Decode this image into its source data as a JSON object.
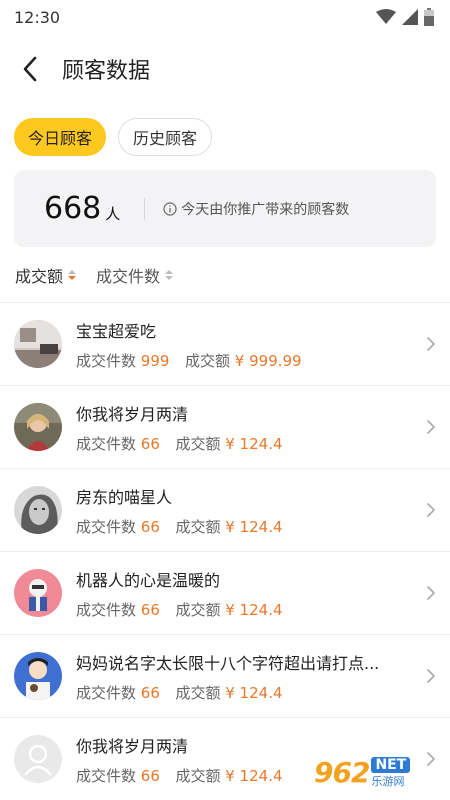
{
  "status_bar": {
    "time": "12:30"
  },
  "header": {
    "title": "顾客数据"
  },
  "tabs": [
    {
      "label": "今日顾客",
      "active": true
    },
    {
      "label": "历史顾客",
      "active": false
    }
  ],
  "summary": {
    "count": "668",
    "unit": "人",
    "note": "今天由你推广带来的顾客数"
  },
  "sort": [
    {
      "label": "成交额",
      "active": true
    },
    {
      "label": "成交件数",
      "active": false
    }
  ],
  "customers": [
    {
      "name": "宝宝超爱吃",
      "qty_label": "成交件数",
      "qty": "999",
      "amount_label": "成交额",
      "amount": "¥ 999.99",
      "avatar": "room-photo"
    },
    {
      "name": "你我将岁月两清",
      "qty_label": "成交件数",
      "qty": "66",
      "amount_label": "成交额",
      "amount": "¥ 124.4",
      "avatar": "girl-photo"
    },
    {
      "name": "房东的喵星人",
      "qty_label": "成交件数",
      "qty": "66",
      "amount_label": "成交额",
      "amount": "¥ 124.4",
      "avatar": "bw-portrait"
    },
    {
      "name": "机器人的心是温暖的",
      "qty_label": "成交件数",
      "qty": "66",
      "amount_label": "成交额",
      "amount": "¥ 124.4",
      "avatar": "cartoon-pink"
    },
    {
      "name": "妈妈说名字太长限十八个字符超出请打点...",
      "qty_label": "成交件数",
      "qty": "66",
      "amount_label": "成交额",
      "amount": "¥ 124.4",
      "avatar": "cartoon-blue"
    },
    {
      "name": "你我将岁月两清",
      "qty_label": "成交件数",
      "qty": "66",
      "amount_label": "成交额",
      "amount": "¥ 124.4",
      "avatar": "default-user"
    }
  ],
  "watermark": {
    "logo": "962",
    "net": "NET",
    "sub": "乐游网"
  },
  "colors": {
    "accent": "#FFC81E",
    "value": "#E9782A",
    "summary_bg": "#F3F3F5"
  }
}
